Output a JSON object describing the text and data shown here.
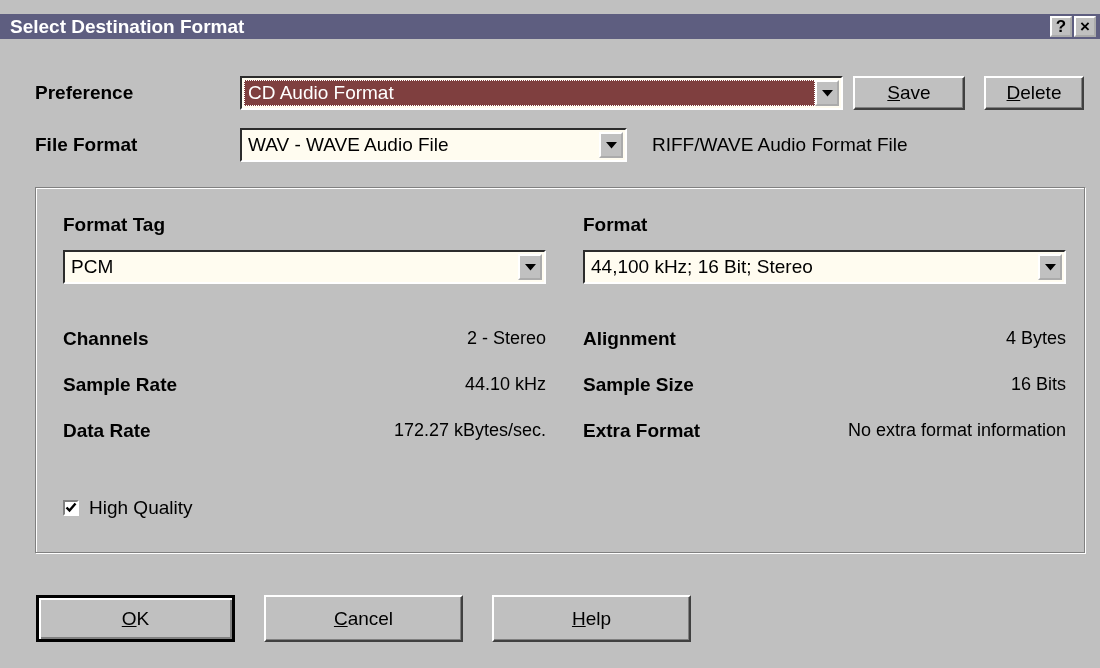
{
  "window": {
    "title": "Select Destination Format",
    "title_buttons": [
      "?",
      "×"
    ]
  },
  "preference": {
    "label": "Preference",
    "value": "CD Audio Format",
    "focused": true
  },
  "preference_buttons": [
    {
      "access_key": "S",
      "label_rest": "ave"
    },
    {
      "access_key": "D",
      "label_rest": "elete"
    }
  ],
  "file_format": {
    "label": "File Format",
    "value": "WAV - WAVE Audio File",
    "description": "RIFF/WAVE Audio Format File"
  },
  "format_tag": {
    "label": "Format Tag",
    "value": "PCM"
  },
  "format": {
    "label": "Format",
    "value": "44,100 kHz; 16 Bit; Stereo"
  },
  "details_left": [
    {
      "label": "Channels",
      "value": "2 - Stereo"
    },
    {
      "label": "Sample Rate",
      "value": "44.10 kHz"
    },
    {
      "label": "Data Rate",
      "value": "172.27 kBytes/sec."
    }
  ],
  "details_right": [
    {
      "label": "Alignment",
      "value": "4 Bytes"
    },
    {
      "label": "Sample Size",
      "value": "16 Bits"
    },
    {
      "label": "Extra Format",
      "value": "No extra format information"
    }
  ],
  "high_quality": {
    "label": "High Quality",
    "checked": true
  },
  "buttons": [
    {
      "access_key": "O",
      "label_rest": "K",
      "default": true
    },
    {
      "access_key": "C",
      "label_rest": "ancel",
      "default": false
    },
    {
      "access_key": "H",
      "label_rest": "elp",
      "default": false
    }
  ]
}
